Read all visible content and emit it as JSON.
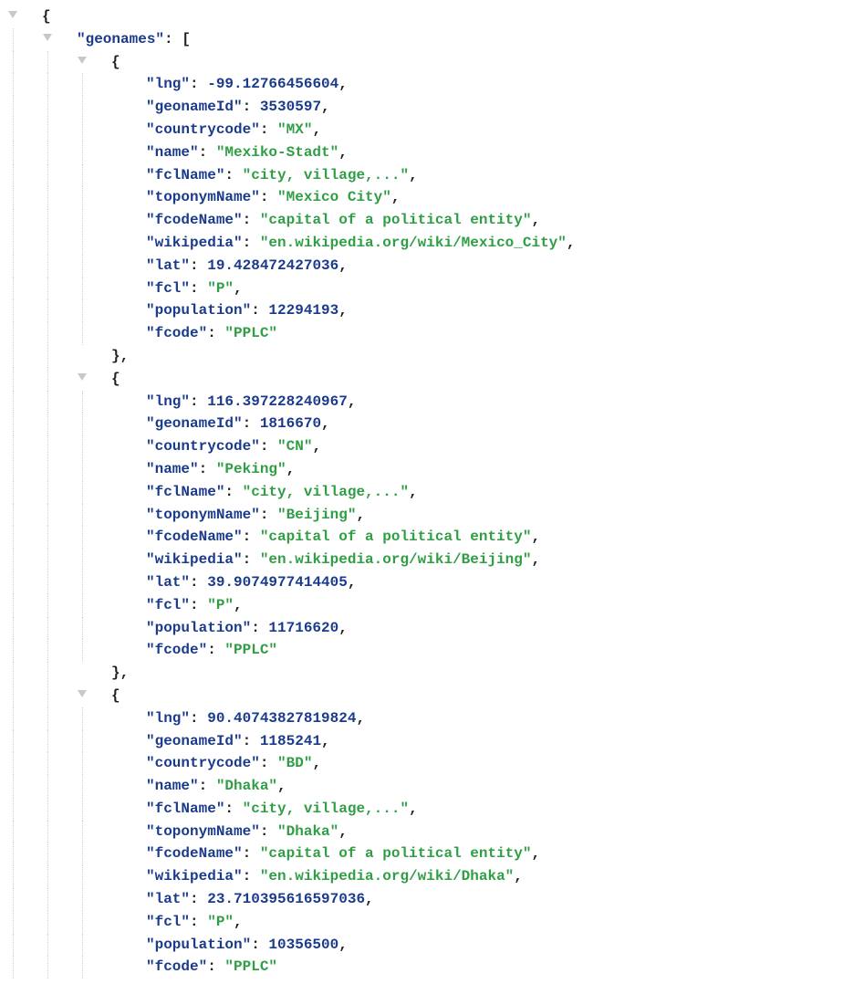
{
  "tree": {
    "arrayKey": "geonames",
    "open": "{",
    "arrayOpen": "[",
    "objOpen": "{",
    "objClose": "}",
    "sep": ",",
    "colon": ": ",
    "items": [
      {
        "props": [
          {
            "k": "lng",
            "t": "num",
            "v": "-99.12766456604"
          },
          {
            "k": "geonameId",
            "t": "num",
            "v": "3530597"
          },
          {
            "k": "countrycode",
            "t": "str",
            "v": "MX"
          },
          {
            "k": "name",
            "t": "str",
            "v": "Mexiko-Stadt"
          },
          {
            "k": "fclName",
            "t": "str",
            "v": "city, village,..."
          },
          {
            "k": "toponymName",
            "t": "str",
            "v": "Mexico City"
          },
          {
            "k": "fcodeName",
            "t": "str",
            "v": "capital of a political entity"
          },
          {
            "k": "wikipedia",
            "t": "str",
            "v": "en.wikipedia.org/wiki/Mexico_City"
          },
          {
            "k": "lat",
            "t": "num",
            "v": "19.428472427036"
          },
          {
            "k": "fcl",
            "t": "str",
            "v": "P"
          },
          {
            "k": "population",
            "t": "num",
            "v": "12294193"
          },
          {
            "k": "fcode",
            "t": "str",
            "v": "PPLC"
          }
        ]
      },
      {
        "props": [
          {
            "k": "lng",
            "t": "num",
            "v": "116.397228240967"
          },
          {
            "k": "geonameId",
            "t": "num",
            "v": "1816670"
          },
          {
            "k": "countrycode",
            "t": "str",
            "v": "CN"
          },
          {
            "k": "name",
            "t": "str",
            "v": "Peking"
          },
          {
            "k": "fclName",
            "t": "str",
            "v": "city, village,..."
          },
          {
            "k": "toponymName",
            "t": "str",
            "v": "Beijing"
          },
          {
            "k": "fcodeName",
            "t": "str",
            "v": "capital of a political entity"
          },
          {
            "k": "wikipedia",
            "t": "str",
            "v": "en.wikipedia.org/wiki/Beijing"
          },
          {
            "k": "lat",
            "t": "num",
            "v": "39.9074977414405"
          },
          {
            "k": "fcl",
            "t": "str",
            "v": "P"
          },
          {
            "k": "population",
            "t": "num",
            "v": "11716620"
          },
          {
            "k": "fcode",
            "t": "str",
            "v": "PPLC"
          }
        ]
      },
      {
        "props": [
          {
            "k": "lng",
            "t": "num",
            "v": "90.40743827819824"
          },
          {
            "k": "geonameId",
            "t": "num",
            "v": "1185241"
          },
          {
            "k": "countrycode",
            "t": "str",
            "v": "BD"
          },
          {
            "k": "name",
            "t": "str",
            "v": "Dhaka"
          },
          {
            "k": "fclName",
            "t": "str",
            "v": "city, village,..."
          },
          {
            "k": "toponymName",
            "t": "str",
            "v": "Dhaka"
          },
          {
            "k": "fcodeName",
            "t": "str",
            "v": "capital of a political entity"
          },
          {
            "k": "wikipedia",
            "t": "str",
            "v": "en.wikipedia.org/wiki/Dhaka"
          },
          {
            "k": "lat",
            "t": "num",
            "v": "23.710395616597036"
          },
          {
            "k": "fcl",
            "t": "str",
            "v": "P"
          },
          {
            "k": "population",
            "t": "num",
            "v": "10356500"
          },
          {
            "k": "fcode",
            "t": "str",
            "v": "PPLC"
          }
        ]
      }
    ]
  }
}
